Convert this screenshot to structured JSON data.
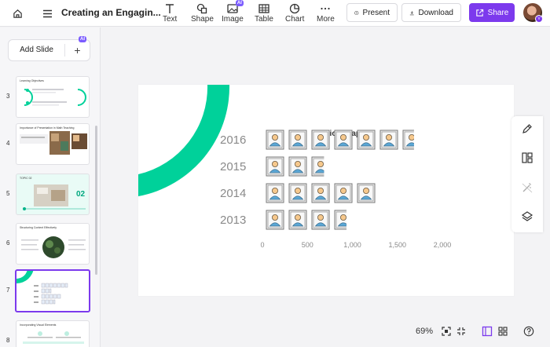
{
  "header": {
    "title": "Creating an Engagin...",
    "tools": [
      {
        "label": "Text",
        "icon": "text-icon"
      },
      {
        "label": "Shape",
        "icon": "shape-icon"
      },
      {
        "label": "Image",
        "icon": "image-icon"
      },
      {
        "label": "Table",
        "icon": "table-icon"
      },
      {
        "label": "Chart",
        "icon": "chart-icon"
      },
      {
        "label": "More",
        "icon": "more-icon"
      }
    ],
    "ai_badge": "AI",
    "present_label": "Present",
    "download_label": "Download",
    "share_label": "Share"
  },
  "sidebar": {
    "add_slide_label": "Add Slide",
    "ai_badge": "AI",
    "slides": [
      {
        "number": "3",
        "title": "Learning Objectives"
      },
      {
        "number": "4",
        "title": "Importance of Presentation in Math Teaching"
      },
      {
        "number": "5",
        "title": "TOPIC 02",
        "big": "02"
      },
      {
        "number": "6",
        "title": "Structuring Content Effectively"
      },
      {
        "number": "7",
        "title": "",
        "active": true
      },
      {
        "number": "8",
        "title": "Incorporating Visual Elements"
      }
    ]
  },
  "chart_data": {
    "type": "pictograph",
    "title": "Pictograph",
    "categories": [
      "2016",
      "2015",
      "2014",
      "2013"
    ],
    "values": [
      1650,
      650,
      1250,
      900
    ],
    "icon_unit": 250,
    "xticks": [
      "0",
      "500",
      "1,000",
      "1,500",
      "2,000"
    ],
    "xlim": [
      0,
      2000
    ],
    "icon": "person-icon",
    "accent_color": "#00d19a"
  },
  "footer": {
    "zoom": "69%"
  }
}
